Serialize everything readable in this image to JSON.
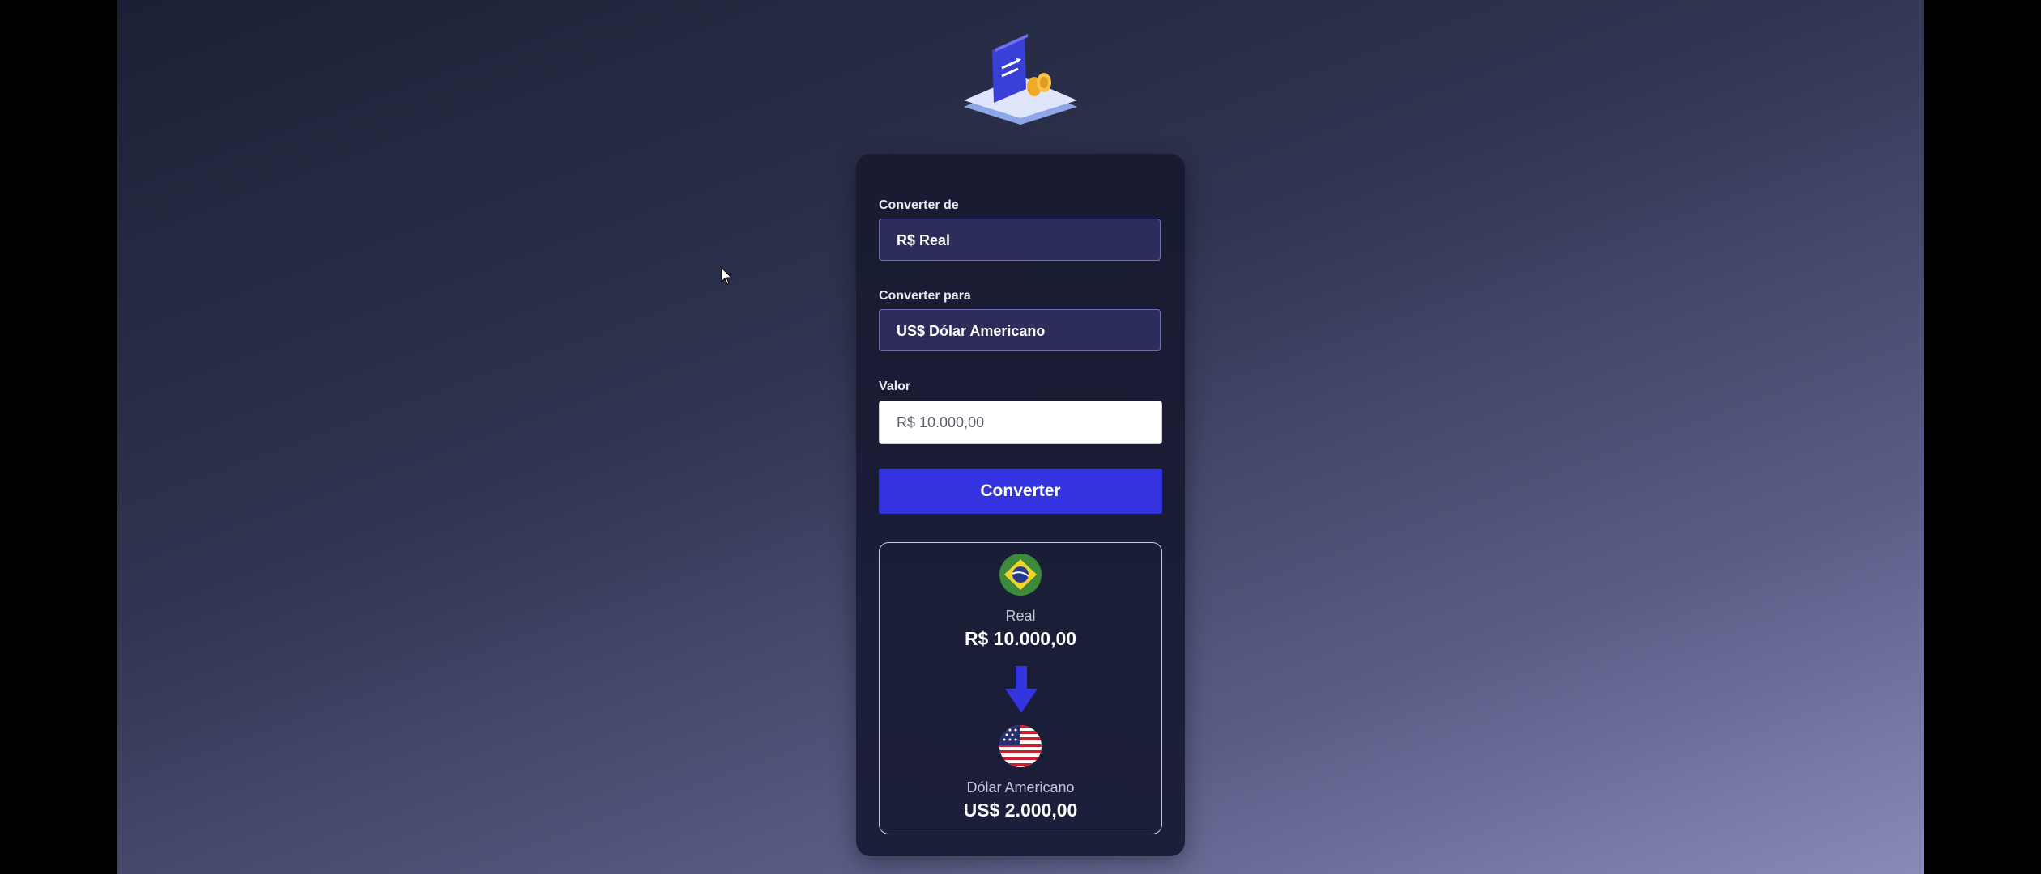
{
  "form": {
    "from_label": "Converter de",
    "from_value": "R$ Real",
    "to_label": "Converter para",
    "to_value": "US$ Dólar Americano",
    "amount_label": "Valor",
    "amount_placeholder": "R$ 10.000,00",
    "convert_label": "Converter"
  },
  "result": {
    "from_currency": "Real",
    "from_value": "R$ 10.000,00",
    "from_flag": "brazil-flag-icon",
    "to_currency": "Dólar Americano",
    "to_value": "US$ 2.000,00",
    "to_flag": "usa-flag-icon",
    "arrow_icon": "arrow-down-icon"
  },
  "logo_icon": "currency-exchange-logo-icon",
  "colors": {
    "accent": "#3333e0",
    "card": "#1a1d35",
    "select_bg": "#2c2d5a"
  }
}
